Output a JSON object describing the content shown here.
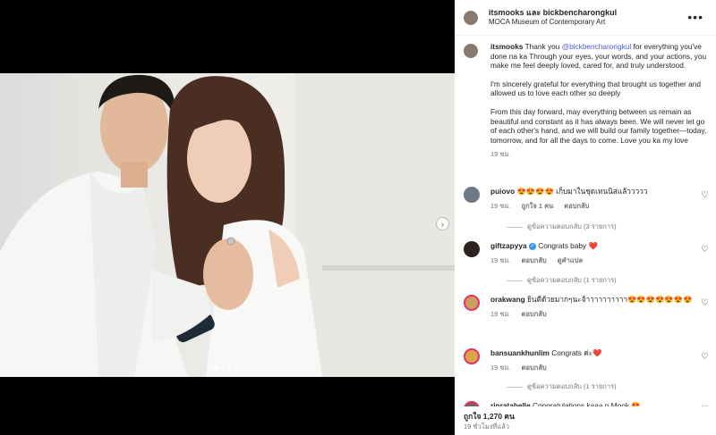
{
  "post": {
    "author_pair": "itsmooks และ bickbencharongkul",
    "location": "MOCA Museum of Contemporary Art",
    "more_icon": "more-horizontal-icon"
  },
  "media": {
    "photo_alt": "Couple photo",
    "next_icon": "chevron-right-icon",
    "next_glyph": "›",
    "slide_count": 4,
    "active_slide": 1
  },
  "caption": {
    "username": "itsmooks",
    "intro": " Thank you ",
    "mention": "@bickbencharongkul",
    "p1_rest": " for everything you've done na ka Through your eyes, your words, and your actions, you make me feel deeply loved, cared for, and truly understood.",
    "p2": "I'm sincerely grateful for everything that brought us together and allowed us to love each other so deeply",
    "p3": "From this day forward, may everything between us remain as beautiful and constant as it has always been. We will never let go of each other's hand, and we will build our family together—today, tomorrow, and for all the days to come. Love you ka my love",
    "time": "19 ชม."
  },
  "comments": [
    {
      "username": "puiovo",
      "text": "😍😍😍😍 เก็บมาในชุดเทนนิสแล้ววววว",
      "time": "19 ชม.",
      "likes": "ถูกใจ 1 คน",
      "reply": "ตอบกลับ",
      "view_replies": "ดูข้อความตอบกลับ (3 รายการ)"
    },
    {
      "username": "giftzapyya",
      "text": "Congrats baby ❤️",
      "time": "19 ชม.",
      "reply": "ตอบกลับ",
      "translate": "ดูคำแปล",
      "view_replies": "ดูข้อความตอบกลับ (1 รายการ)",
      "verified": true
    },
    {
      "username": "orakwang",
      "text": "ยินดีด้วยมากๆนะจ้าาาาาาาาาา😍😍😍😍😍😍😍",
      "time": "19 ชม.",
      "reply": "ตอบกลับ"
    },
    {
      "username": "bansuankhunlim",
      "text": "Congrats ค่ะ❤️",
      "time": "19 ชม.",
      "reply": "ตอบกลับ",
      "view_replies": "ดูข้อความตอบกลับ (1 รายการ)"
    },
    {
      "username": "rinratabelle",
      "text": "Congratulations kaaa p Mook 😍"
    }
  ],
  "footer": {
    "likes": "ถูกใจ 1,270 คน",
    "ago": "19 ชั่วโมงที่แล้ว"
  },
  "icons": {
    "heart": "heart-outline-icon"
  },
  "colors": {
    "mention": "#4c5bd4",
    "verified": "#3897f0",
    "muted": "#737373"
  }
}
